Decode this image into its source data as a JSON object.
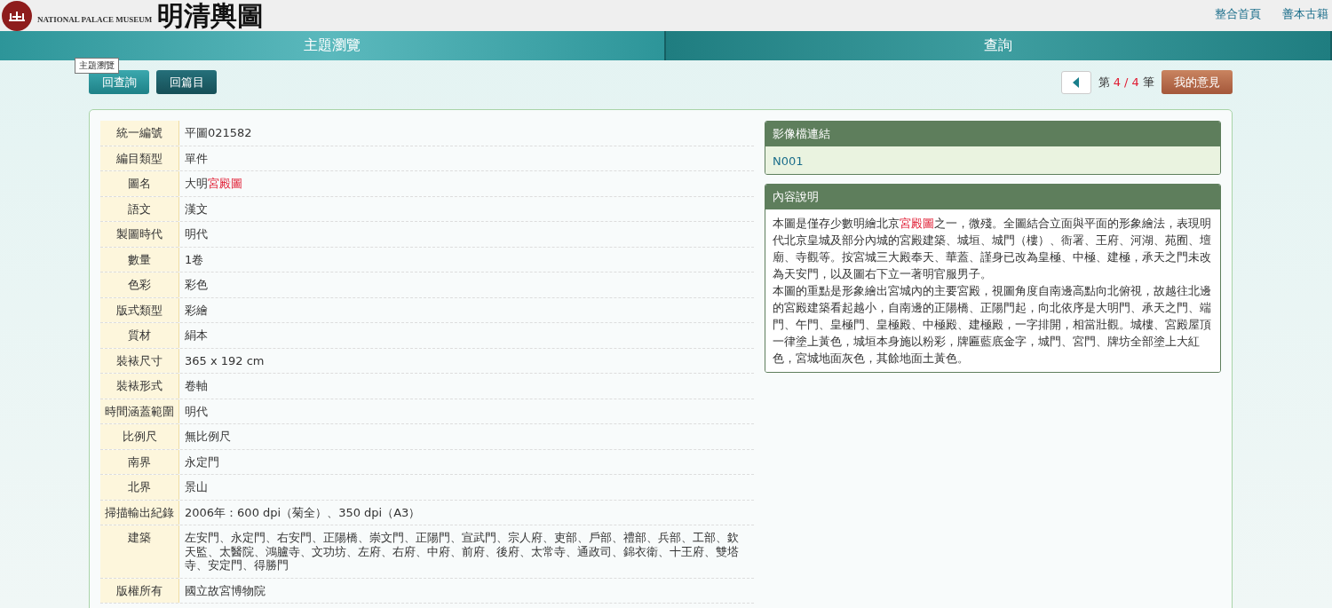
{
  "header": {
    "museum_name": "NATIONAL PALACE MUSEUM",
    "site_title": "明清輿圖",
    "links": [
      "整合首頁",
      "善本古籍"
    ]
  },
  "nav_tabs": [
    {
      "label": "主題瀏覽",
      "selected": true
    },
    {
      "label": "查詢",
      "selected": false
    }
  ],
  "tooltip": "主題瀏覽",
  "toolbar": {
    "buttons": [
      "回查詢",
      "回篇目"
    ],
    "record_prefix": "第",
    "record_current": "4",
    "record_sep": "/",
    "record_total": "4",
    "record_suffix": "筆",
    "feedback_button": "我的意見"
  },
  "fields": [
    {
      "label": "統一編號",
      "value": [
        {
          "text": "平圖021582",
          "highlight": false
        }
      ]
    },
    {
      "label": "編目類型",
      "value": [
        {
          "text": "單件",
          "highlight": false
        }
      ]
    },
    {
      "label": "圖名",
      "value": [
        {
          "text": "大明",
          "highlight": false
        },
        {
          "text": "宮殿圖",
          "highlight": true
        }
      ]
    },
    {
      "label": "語文",
      "value": [
        {
          "text": "漢文",
          "highlight": false
        }
      ]
    },
    {
      "label": "製圖時代",
      "value": [
        {
          "text": "明代",
          "highlight": false
        }
      ]
    },
    {
      "label": "數量",
      "value": [
        {
          "text": "1卷",
          "highlight": false
        }
      ]
    },
    {
      "label": "色彩",
      "value": [
        {
          "text": "彩色",
          "highlight": false
        }
      ]
    },
    {
      "label": "版式類型",
      "value": [
        {
          "text": "彩繪",
          "highlight": false
        }
      ]
    },
    {
      "label": "質材",
      "value": [
        {
          "text": "絹本",
          "highlight": false
        }
      ]
    },
    {
      "label": "裝裱尺寸",
      "value": [
        {
          "text": "365 x 192 cm",
          "highlight": false
        }
      ]
    },
    {
      "label": "裝裱形式",
      "value": [
        {
          "text": "卷軸",
          "highlight": false
        }
      ]
    },
    {
      "label": "時間涵蓋範圍",
      "value": [
        {
          "text": "明代",
          "highlight": false
        }
      ]
    },
    {
      "label": "比例尺",
      "value": [
        {
          "text": "無比例尺",
          "highlight": false
        }
      ]
    },
    {
      "label": "南界",
      "value": [
        {
          "text": "永定門",
          "highlight": false
        }
      ]
    },
    {
      "label": "北界",
      "value": [
        {
          "text": "景山",
          "highlight": false
        }
      ]
    },
    {
      "label": "掃描輸出紀錄",
      "value": [
        {
          "text": "2006年：600 dpi（菊全）、350 dpi（A3）",
          "highlight": false
        }
      ]
    },
    {
      "label": "建築",
      "value": [
        {
          "text": "左安門、永定門、右安門、正陽橋、崇文門、正陽門、宣武門、宗人府、吏部、戶部、禮部、兵部、工部、欽天監、太醫院、鴻臚寺、文功坊、左府、右府、中府、前府、後府、太常寺、通政司、錦衣衛、十王府、雙塔寺、安定門、得勝門",
          "highlight": false
        }
      ]
    },
    {
      "label": "版權所有",
      "value": [
        {
          "text": "國立故宮博物院",
          "highlight": false
        }
      ]
    }
  ],
  "image_link_panel": {
    "title": "影像檔連結",
    "link": "N001"
  },
  "description_panel": {
    "title": "內容說明",
    "paragraphs": [
      [
        {
          "text": "本圖是僅存少數明繪北京",
          "highlight": false
        },
        {
          "text": "宮殿圖",
          "highlight": true
        },
        {
          "text": "之一，微殘。全圖結合立面與平面的形象繪法，表現明代北京皇城及部分內城的宮殿建築、城垣、城門（樓）、衙署、王府、河湖、苑囿、壇廟、寺觀等。按宮城三大殿奉天、華蓋、謹身已改為皇極、中極、建極，承天之門未改為天安門，以及圖右下立一著明官服男子。",
          "highlight": false
        }
      ],
      [
        {
          "text": "本圖的重點是形象繪出宮城內的主要宮殿，視圖角度自南邊高點向北俯視，故越往北邊的宮殿建築看起越小，自南邊的正陽橋、正陽門起，向北依序是大明門、承天之門、端門、午門、皇極門、皇極殿、中極殿、建極殿，一字排開，相當壯觀。城樓、宮殿屋頂一律塗上黃色，城垣本身施以粉彩，牌匾藍底金字，城門、宮門、牌坊全部塗上大紅色，宮城地面灰色，其餘地面土黃色。",
          "highlight": false
        }
      ]
    ]
  }
}
